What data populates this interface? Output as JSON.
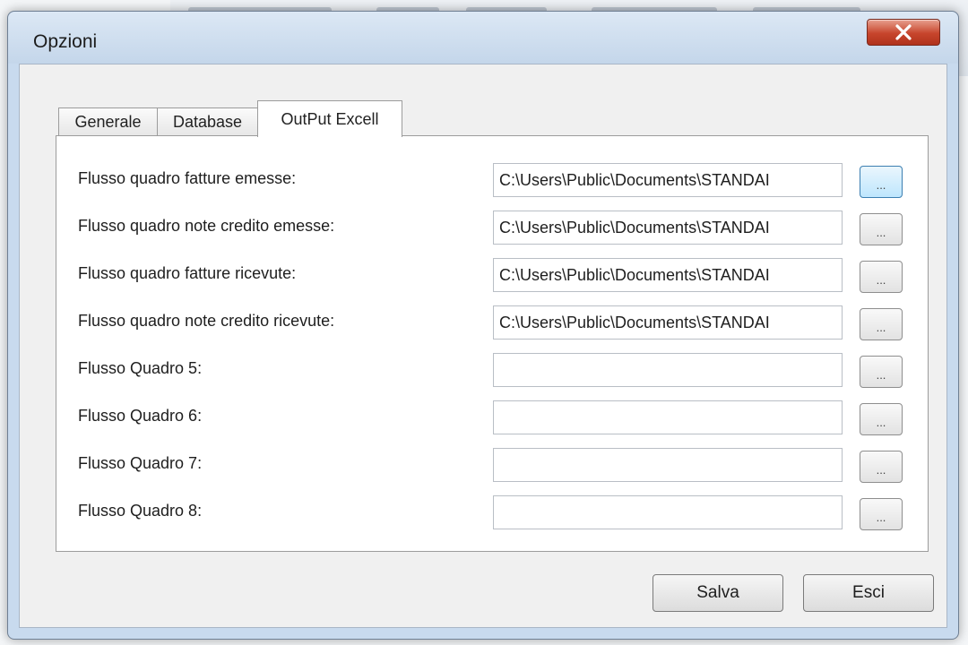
{
  "window": {
    "title": "Opzioni"
  },
  "tabs": [
    {
      "label": "Generale",
      "active": false
    },
    {
      "label": "Database",
      "active": false
    },
    {
      "label": "OutPut Excell",
      "active": true
    }
  ],
  "rows": [
    {
      "label": "Flusso quadro fatture emesse:",
      "value": "C:\\Users\\Public\\Documents\\STANDAI",
      "button": "..."
    },
    {
      "label": "Flusso quadro note credito emesse:",
      "value": "C:\\Users\\Public\\Documents\\STANDAI",
      "button": "..."
    },
    {
      "label": "Flusso quadro fatture ricevute:",
      "value": "C:\\Users\\Public\\Documents\\STANDAI",
      "button": "..."
    },
    {
      "label": "Flusso quadro note credito ricevute:",
      "value": "C:\\Users\\Public\\Documents\\STANDAI",
      "button": "..."
    },
    {
      "label": "Flusso Quadro 5:",
      "value": "",
      "button": "..."
    },
    {
      "label": "Flusso Quadro 6:",
      "value": "",
      "button": "..."
    },
    {
      "label": "Flusso Quadro 7:",
      "value": "",
      "button": "..."
    },
    {
      "label": "Flusso Quadro 8:",
      "value": "",
      "button": "..."
    }
  ],
  "actions": {
    "save_label": "Salva",
    "exit_label": "Esci"
  },
  "icons": {
    "close": "close-icon"
  },
  "colors": {
    "close_button": "#c7452c",
    "focused_button": "#bee6fd"
  }
}
